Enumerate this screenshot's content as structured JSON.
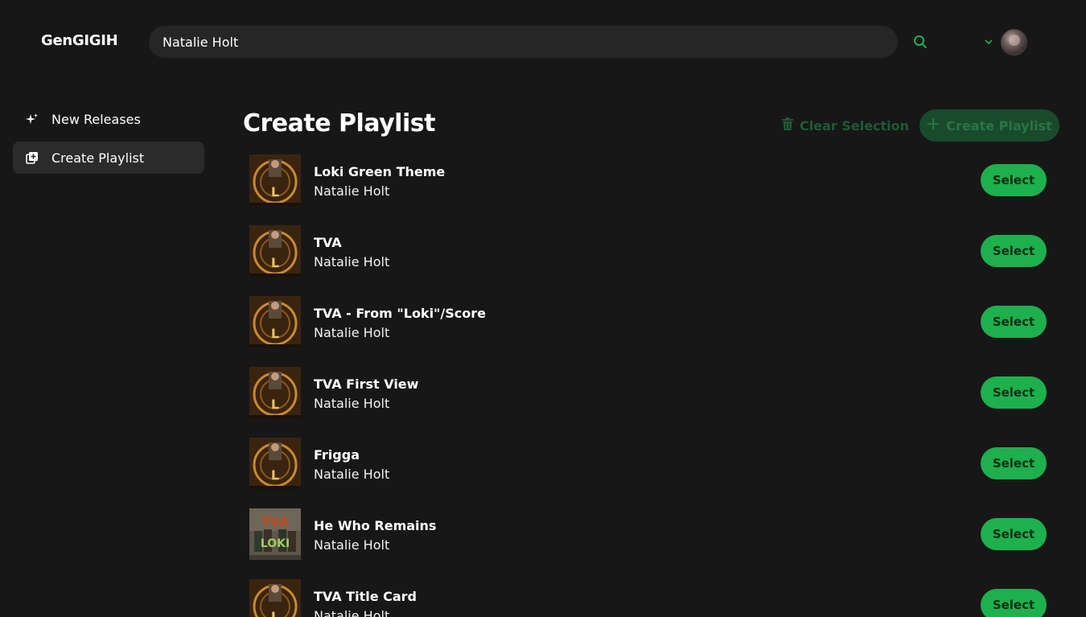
{
  "app": {
    "logo": "GenGIGIH"
  },
  "search": {
    "value": "Natalie Holt"
  },
  "sidebar": {
    "items": [
      {
        "label": "New Releases",
        "icon": "sparkle-icon",
        "active": false
      },
      {
        "label": "Create Playlist",
        "icon": "playlist-add-icon",
        "active": true
      }
    ]
  },
  "main": {
    "title": "Create Playlist",
    "clear_label": "Clear Selection",
    "create_label": "Create Playlist"
  },
  "tracks": [
    {
      "title": "Loki Green Theme",
      "artist": "Natalie Holt",
      "button": "Select",
      "cover": "loki-cover"
    },
    {
      "title": "TVA",
      "artist": "Natalie Holt",
      "button": "Select",
      "cover": "loki-cover"
    },
    {
      "title": "TVA - From \"Loki\"/Score",
      "artist": "Natalie Holt",
      "button": "Select",
      "cover": "loki-cover"
    },
    {
      "title": "TVA First View",
      "artist": "Natalie Holt",
      "button": "Select",
      "cover": "loki-cover"
    },
    {
      "title": "Frigga",
      "artist": "Natalie Holt",
      "button": "Select",
      "cover": "loki-cover"
    },
    {
      "title": "He Who Remains",
      "artist": "Natalie Holt",
      "button": "Select",
      "cover": "tva-cover"
    },
    {
      "title": "TVA Title Card",
      "artist": "Natalie Holt",
      "button": "Select",
      "cover": "loki-cover"
    }
  ],
  "colors": {
    "background": "#171717",
    "accent": "#1db04d",
    "accent_dim": "#1a4a2c",
    "search_bg": "#262626"
  }
}
